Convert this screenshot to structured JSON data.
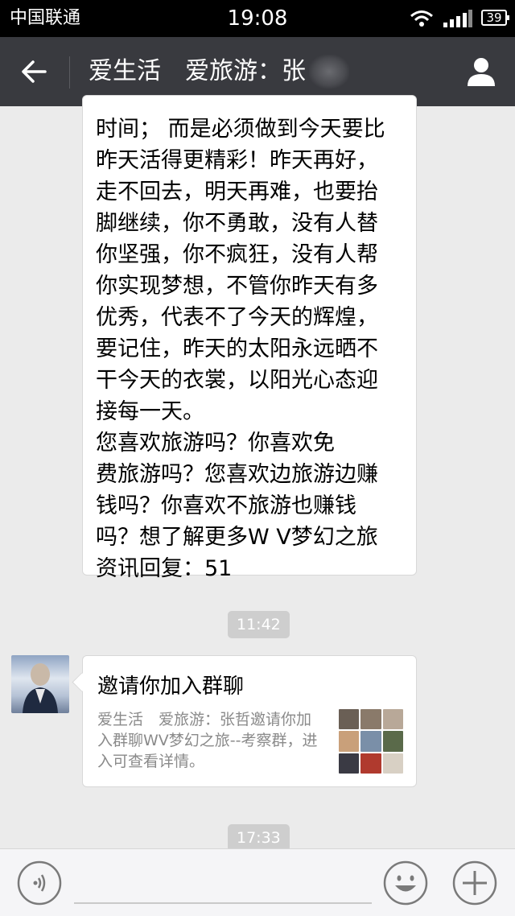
{
  "status_bar": {
    "carrier": "中国联通",
    "time": "19:08",
    "battery": "39"
  },
  "nav": {
    "title": "爱生活　爱旅游：张"
  },
  "messages": [
    {
      "text": "时间；  而是必须做到今天要比\n昨天活得更精彩！昨天再好，\n走不回去，明天再难，也要抬\n脚继续，你不勇敢，没有人替\n你坚强，你不疯狂，没有人帮\n你实现梦想，不管你昨天有多\n优秀，代表不了今天的辉煌，\n要记住，昨天的太阳永远晒不\n干今天的衣裳，以阳光心态迎\n接每一天。\n     您喜欢旅游吗？你喜欢免\n费旅游吗？您喜欢边旅游边赚\n钱吗？你喜欢不旅游也赚钱\n吗？想了解更多W V梦幻之旅\n资讯回复：51"
    }
  ],
  "timestamps": [
    "11:42",
    "17:33"
  ],
  "invite_card": {
    "title": "邀请你加入群聊",
    "description": "爱生活　爱旅游：张哲邀请你加入群聊WV梦幻之旅--考察群，进入可查看详情。"
  },
  "icons": {
    "back": "arrow-left-icon",
    "profile": "person-icon",
    "voice": "voice-icon",
    "emoji": "emoji-icon",
    "plus": "plus-icon"
  },
  "colors": {
    "nav_bg": "#393a3f",
    "chat_bg": "#ebebeb",
    "timestamp_bg": "#cecece"
  }
}
